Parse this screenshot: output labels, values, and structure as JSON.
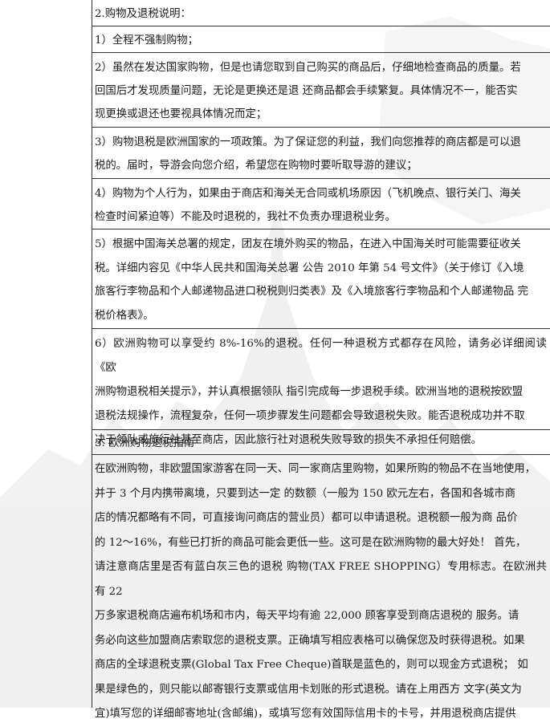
{
  "rows": [
    {
      "lines": [
        "2.购物及退税说明："
      ]
    },
    {
      "lines": [
        "1）全程不强制购物；"
      ]
    },
    {
      "lines": [
        "2）虽然在发达国家购物，但是也请您取到自己购买的商品后，仔细地检查商品的质量。若",
        "回国后才发现质量问题，无论是更换还是退 还商品都会手续繁复。具体情况不一，能否实",
        "现更换或退还也要视具体情况而定；"
      ]
    },
    {
      "lines": [
        "3）购物退税是欧洲国家的一项政策。为了保证您的利益，我们向您推荐的商店都是可以退",
        "税的。届时，导游会向您介绍，希望您在购物时要听取导游的建议；"
      ]
    },
    {
      "lines": [
        "4）购物为个人行为，如果由于商店和海关无合同或机场原因（飞机晚点、银行关门、海关",
        "检查时间紧迫等）不能及时退税的，我社不负责办理退税业务。"
      ]
    },
    {
      "lines": [
        "5）根据中国海关总署的规定，团友在境外购买的物品，在进入中国海关时可能需要征收关",
        "税。详细内容见《中华人民共和国海关总署 公告 2010 年第 54 号文件》（关于修订《入境",
        "旅客行李物品和个人邮递物品进口税税则归类表》及《入境旅客行李物品和个人邮递物品 完",
        "税价格表》。"
      ]
    },
    {
      "lines": [
        "6）欧洲购物可以享受约 8%-16%的退税。任何一种退税方式都存在风险，请务必详细阅读《欧",
        "洲购物退税相关提示》，并认真根据领队 指引完成每一步退税手续。欧洲当地的退税按欧盟",
        "退税法规操作，流程复杂，任何一项步骤发生问题都会导致退税失败。能否退税成功并不取",
        "决于领队或旅行社甚至商店，因此旅行社对退税失败导致的损失不承担任何赔偿。"
      ]
    },
    {
      "lines": [
        "3. 欧洲购物退税指南"
      ]
    },
    {
      "lines": [
        "在欧洲购物，非欧盟国家游客在同一天、同一家商店里购物，如果所购的物品不在当地使用，",
        "并于 3 个月内携带离境，只要到达一定 的数额（一般为 150 欧元左右，各国和各城市商",
        "店的情况都略有不同，可直接询问商店的营业员）都可以申请退税。退税额一般为商 品价",
        "的 12～16%，有些已打折的商品可能会更低一些。这可是在欧洲购物的最大好处！ 首先，",
        "请注意商店里是否有蓝白灰三色的退税 购物(TAX FREE SHOPPING）专用标志。在欧洲共有 22",
        "万多家退税商店遍布机场和市内，每天平均有逾 22,000 顾客享受到商店退税的 服务。请",
        "务必向这些加盟商店索取您的退税支票。正确填写相应表格可以确保您及时获得退税。如果",
        "商店的全球退税支票(Global Tax Free Cheque)首联是蓝色的，则可以现金方式退税； 如",
        "果是绿色的，则只能以邮寄银行支票或信用卡划账的形式退税。请在上用西方 文字(英文为",
        "宜)填写您的详细邮寄地址(含邮编)，或填写您有效国际信用卡的卡号，并用退税商店提供"
      ]
    }
  ]
}
